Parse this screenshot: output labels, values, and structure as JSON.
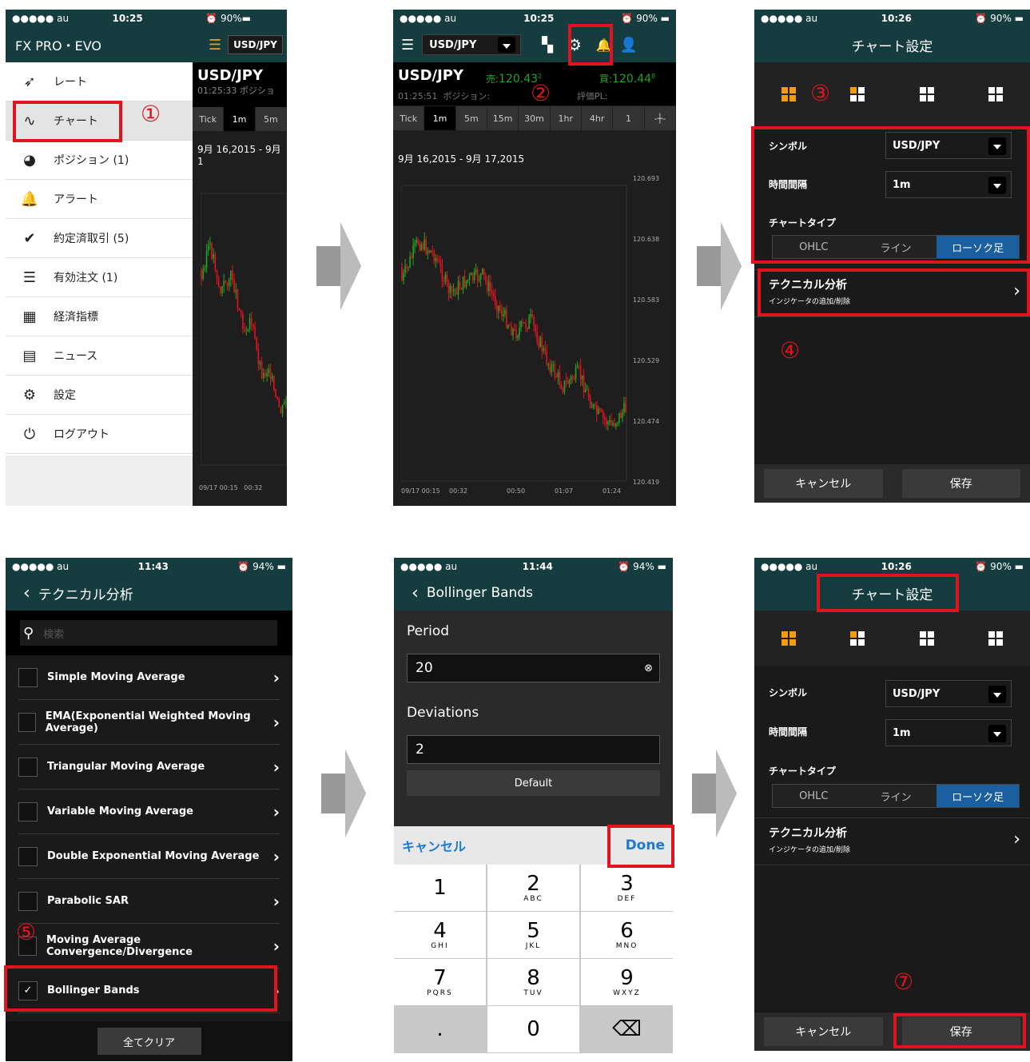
{
  "status": {
    "carrier": "●●●●● au",
    "p1_time": "10:25",
    "p2_time": "10:25",
    "p3_time": "10:26",
    "p4_time": "11:43",
    "p5_time": "11:44",
    "p6_time": "10:26",
    "battery90": "90%",
    "battery94": "94%"
  },
  "markers": [
    "①",
    "②",
    "③",
    "④",
    "⑤",
    "⑦"
  ],
  "menu": {
    "app_title": "FX PRO・EVO",
    "items": [
      {
        "label": "レート",
        "icon": "➶"
      },
      {
        "label": "チャート",
        "icon": "∿"
      },
      {
        "label": "ポジション (1)",
        "icon": "◕"
      },
      {
        "label": "アラート",
        "icon": "🔔"
      },
      {
        "label": "約定済取引 (5)",
        "icon": "✔"
      },
      {
        "label": "有効注文 (1)",
        "icon": "☰"
      },
      {
        "label": "経済指標",
        "icon": "▦"
      },
      {
        "label": "ニュース",
        "icon": "▤"
      },
      {
        "label": "設定",
        "icon": "⚙"
      },
      {
        "label": "ログアウト",
        "icon": "⏻"
      }
    ]
  },
  "chart_screen": {
    "symbol": "USD/JPY",
    "pair_title": "USD/JPY",
    "sell_label": "売:",
    "sell_main": "120.43",
    "sell_sup": "2",
    "buy_label": "買:",
    "buy_main": "120.44",
    "buy_sup": "8",
    "time": "01:25:51",
    "position_label": "ポジション:",
    "pl_label": "評価PL:",
    "partial_time": "01:25:33",
    "partial_position": "ポジショ",
    "timeframes": [
      "Tick",
      "1m",
      "5m",
      "15m",
      "30m",
      "1hr",
      "4hr",
      "1"
    ],
    "date_range": "9月 16,2015 - 9月 17,2015",
    "partial_date_range": "9月 16,2015 - 9月 1",
    "yaxis": [
      "120.693",
      "120.638",
      "120.583",
      "120.529",
      "120.474",
      "120.419"
    ],
    "xaxis": [
      "09/17 00:15",
      "00:32",
      "00:50",
      "01:07",
      "01:24"
    ]
  },
  "settings": {
    "title": "チャート設定",
    "symbol_label": "シンボル",
    "symbol_value": "USD/JPY",
    "interval_label": "時間間隔",
    "interval_value": "1m",
    "chart_type_label": "チャートタイプ",
    "chart_types": [
      "OHLC",
      "ライン",
      "ローソク足"
    ],
    "tech_title": "テクニカル分析",
    "tech_sub": "インジケータの追加/削除",
    "cancel": "キャンセル",
    "save": "保存"
  },
  "tech_list": {
    "title": "テクニカル分析",
    "search_placeholder": "検索",
    "items": [
      "Simple Moving Average",
      "EMA(Exponential Weighted Moving Average)",
      "Triangular Moving Average",
      "Variable Moving Average",
      "Double Exponential Moving Average",
      "Parabolic SAR",
      "Moving Average Convergence/Divergence",
      "Bollinger Bands"
    ],
    "clear_all": "全てクリア"
  },
  "bollinger": {
    "title": "Bollinger Bands",
    "period_label": "Period",
    "period_value": "20",
    "deviations_label": "Deviations",
    "deviations_value": "2",
    "default_btn": "Default",
    "kb_cancel": "キャンセル",
    "kb_done": "Done",
    "keys": [
      {
        "d": "1",
        "l": ""
      },
      {
        "d": "2",
        "l": "ABC"
      },
      {
        "d": "3",
        "l": "DEF"
      },
      {
        "d": "4",
        "l": "GHI"
      },
      {
        "d": "5",
        "l": "JKL"
      },
      {
        "d": "6",
        "l": "MNO"
      },
      {
        "d": "7",
        "l": "PQRS"
      },
      {
        "d": "8",
        "l": "TUV"
      },
      {
        "d": "9",
        "l": "WXYZ"
      },
      {
        "d": ".",
        "l": ""
      },
      {
        "d": "0",
        "l": ""
      },
      {
        "d": "⌫",
        "l": ""
      }
    ]
  },
  "colors": {
    "teal": "#153d3f",
    "red_highlight": "#e0141e",
    "candle_up": "#22a322",
    "candle_down": "#e0141e",
    "active_blue": "#1a5fa0",
    "orange": "#f39c12"
  }
}
